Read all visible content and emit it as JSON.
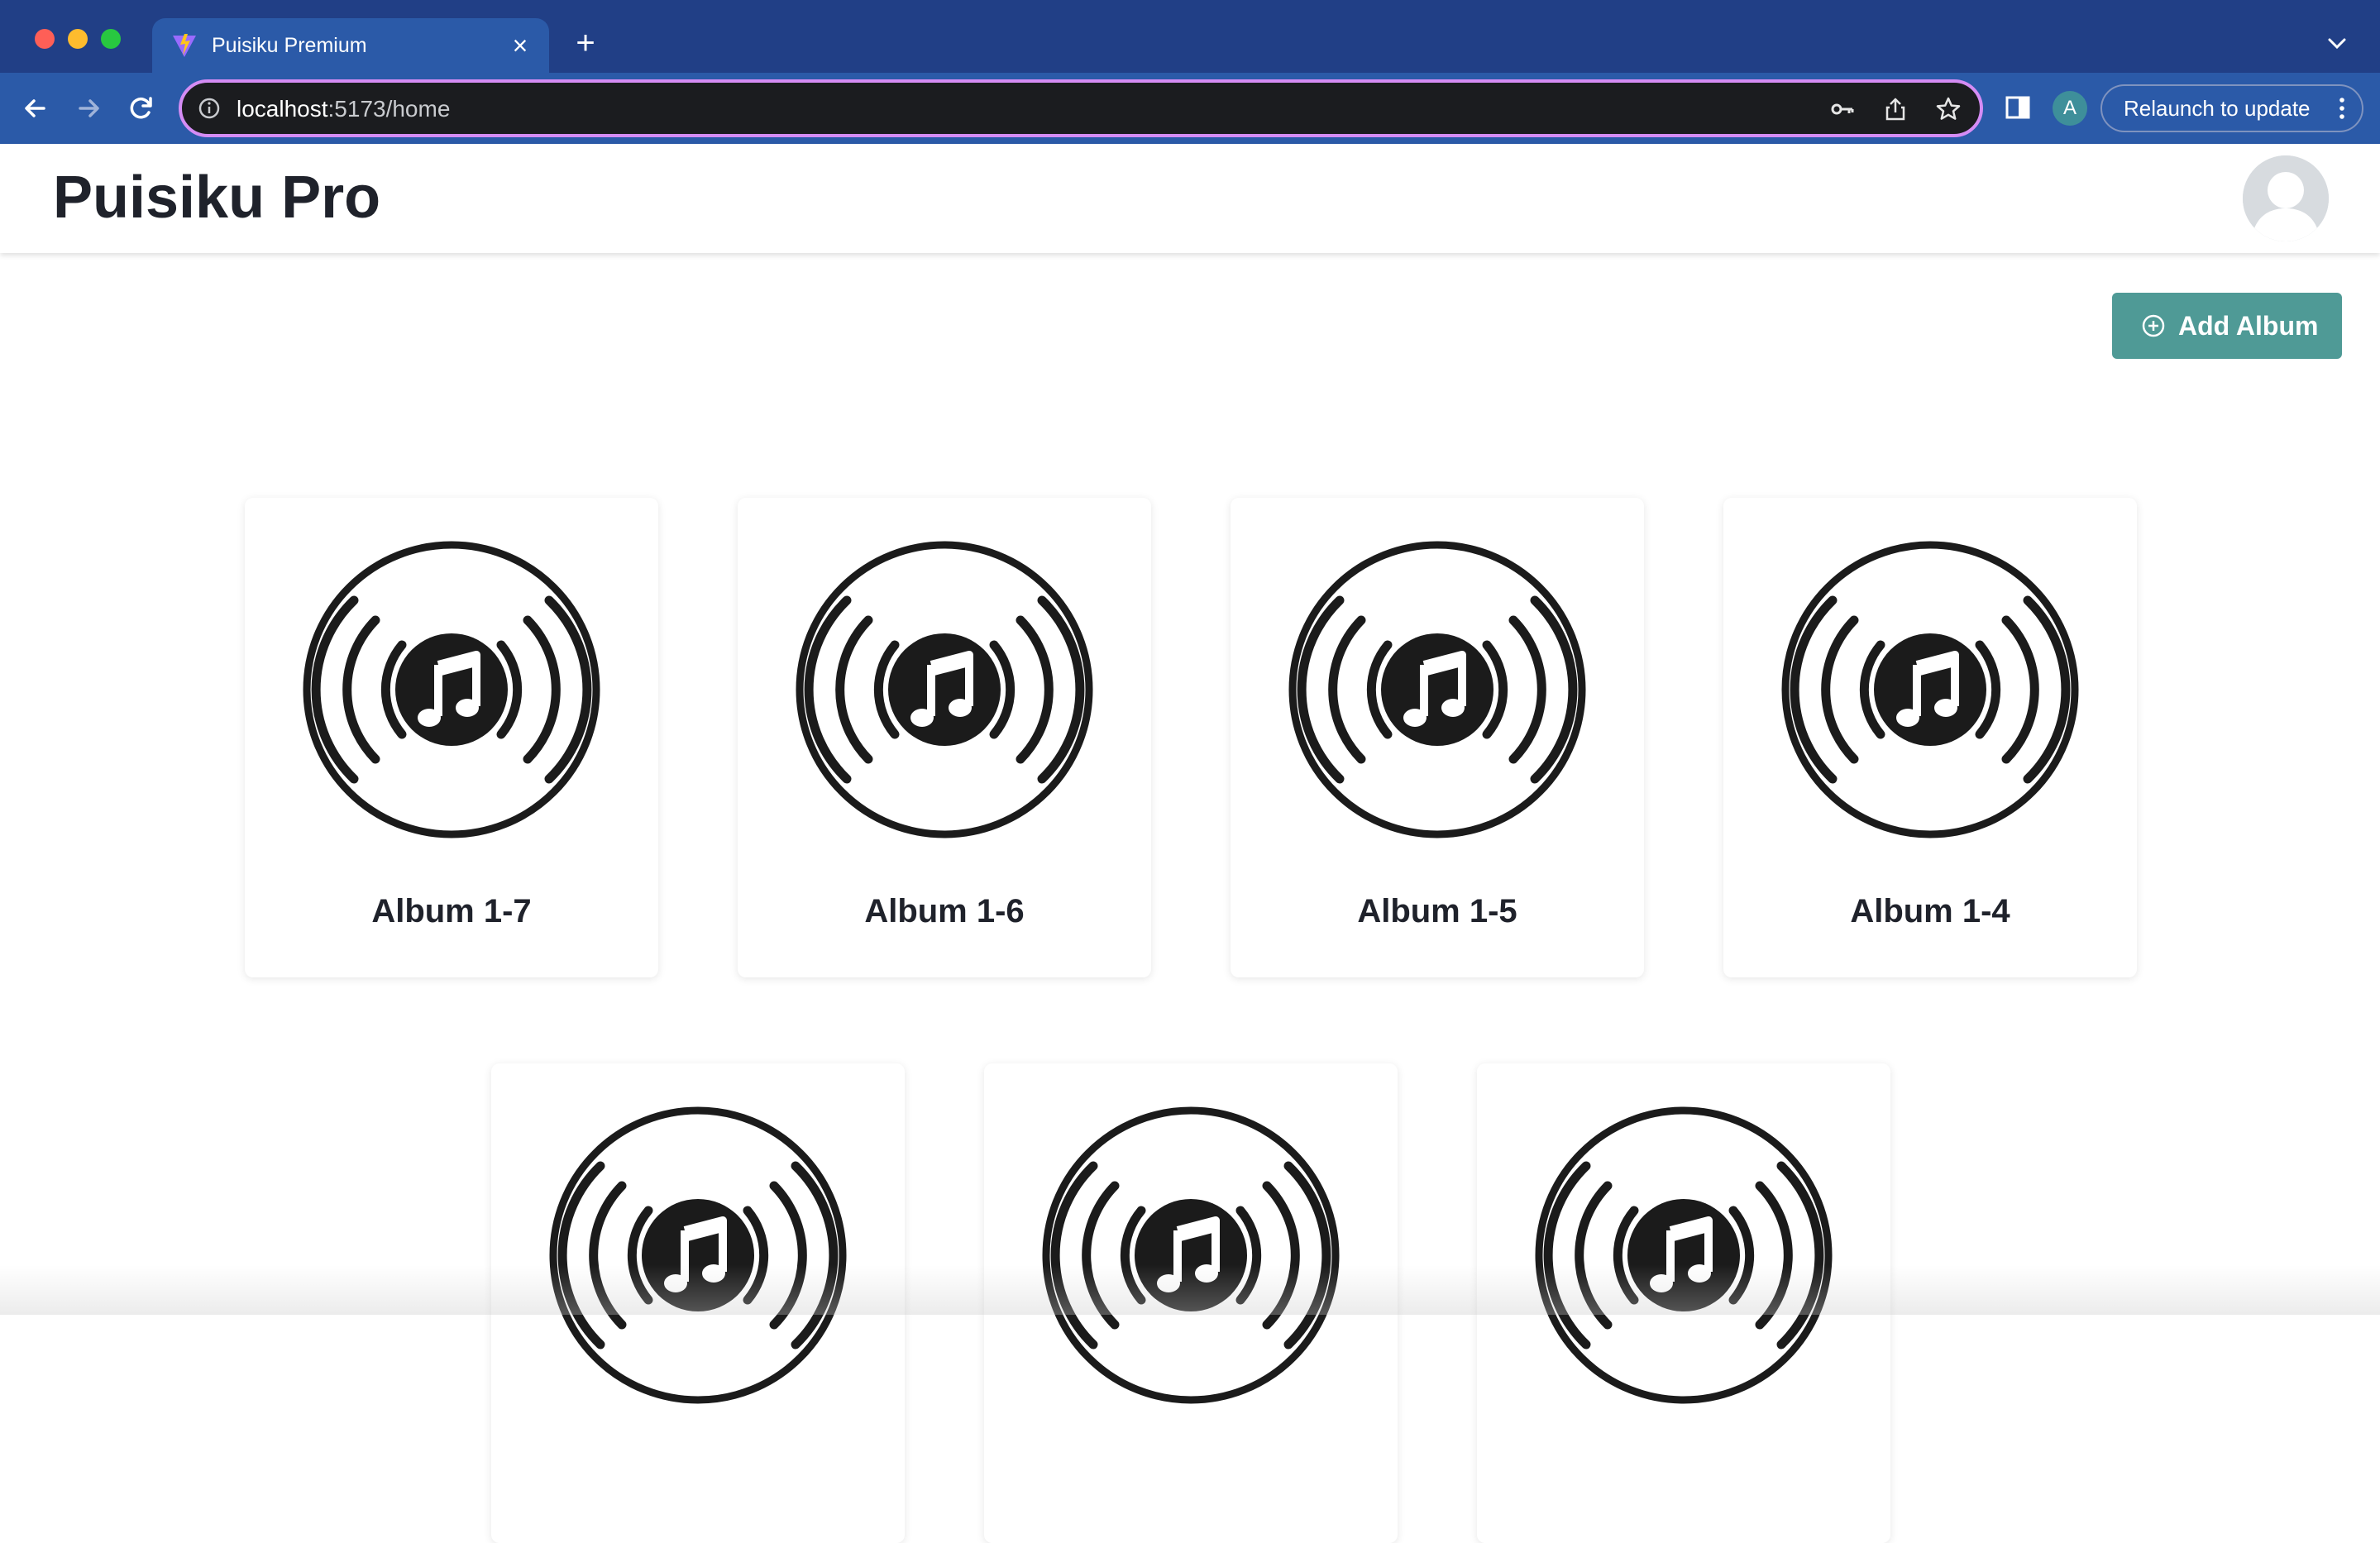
{
  "browser": {
    "tab": {
      "title": "Puisiku Premium",
      "favicon": "vite-favicon-icon",
      "close": "×"
    },
    "new_tab": "+",
    "url": {
      "host": "localhost",
      "path": ":5173/home"
    },
    "profile_initial": "A",
    "relaunch_label": "Relaunch to update"
  },
  "app": {
    "title": "Puisiku Pro",
    "avatar": "default-user-avatar"
  },
  "toolbar": {
    "add_album_label": "Add Album",
    "add_album_icon": "plus-circle-icon"
  },
  "albums": [
    {
      "name": "Album 1-7",
      "icon": "music-disc-icon"
    },
    {
      "name": "Album 1-6",
      "icon": "music-disc-icon"
    },
    {
      "name": "Album 1-5",
      "icon": "music-disc-icon"
    },
    {
      "name": "Album 1-4",
      "icon": "music-disc-icon"
    },
    {
      "name": "",
      "icon": "music-disc-icon"
    },
    {
      "name": "",
      "icon": "music-disc-icon"
    },
    {
      "name": "",
      "icon": "music-disc-icon"
    }
  ],
  "colors": {
    "chrome": "#213f86",
    "accent_button": "#4f9a96",
    "omnibox_border": "#d58cf4",
    "text_dark": "#1f222b"
  }
}
